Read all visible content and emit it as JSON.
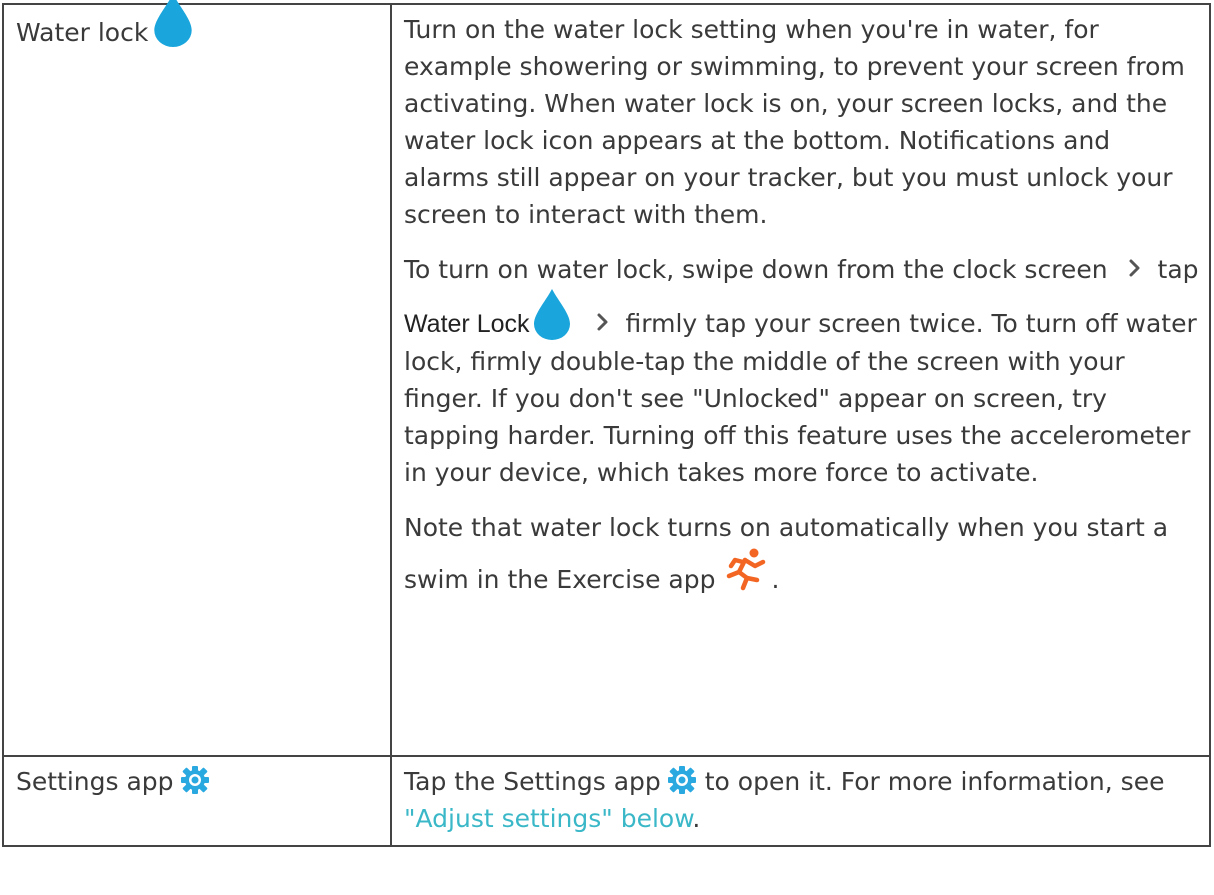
{
  "rows": [
    {
      "label": "Water lock",
      "label_icon": "water-drop-icon",
      "paragraphs": {
        "p1": "Turn on the water lock setting when you're in water, for example showering or swimming, to prevent your screen from activating. When water lock is on, your screen locks, and the water lock icon appears at the bottom. Notifications and alarms still appear on your tracker, but you must unlock your screen to interact with them.",
        "p2_a": "To turn on water lock, swipe down from the clock screen",
        "p2_b": "tap",
        "p2_bold": "Water Lock",
        "p2_c": "firmly tap your screen twice. To turn off water lock, firmly double-tap the middle of the screen with your finger. If you don't see \"Unlocked\" appear on screen, try tapping harder. Turning off this feature uses the accelerometer in your device, which takes more force to activate.",
        "p3_a": "Note that water lock turns on automatically when you start a swim in the Exercise app",
        "p3_end": "."
      }
    },
    {
      "label": "Settings app",
      "label_icon": "settings-gear-icon",
      "desc_a": "Tap the Settings app",
      "desc_b": "to open it. For more information, see",
      "link": "\"Adjust settings\" below",
      "desc_end": "."
    }
  ],
  "colors": {
    "water_drop": "#1aa6dc",
    "gear": "#2aa8e0",
    "runner": "#f26522",
    "link": "#3bb8c8",
    "border": "#444444"
  },
  "icons": [
    "water-drop-icon",
    "chevron-right-icon",
    "exercise-runner-icon",
    "settings-gear-icon"
  ]
}
